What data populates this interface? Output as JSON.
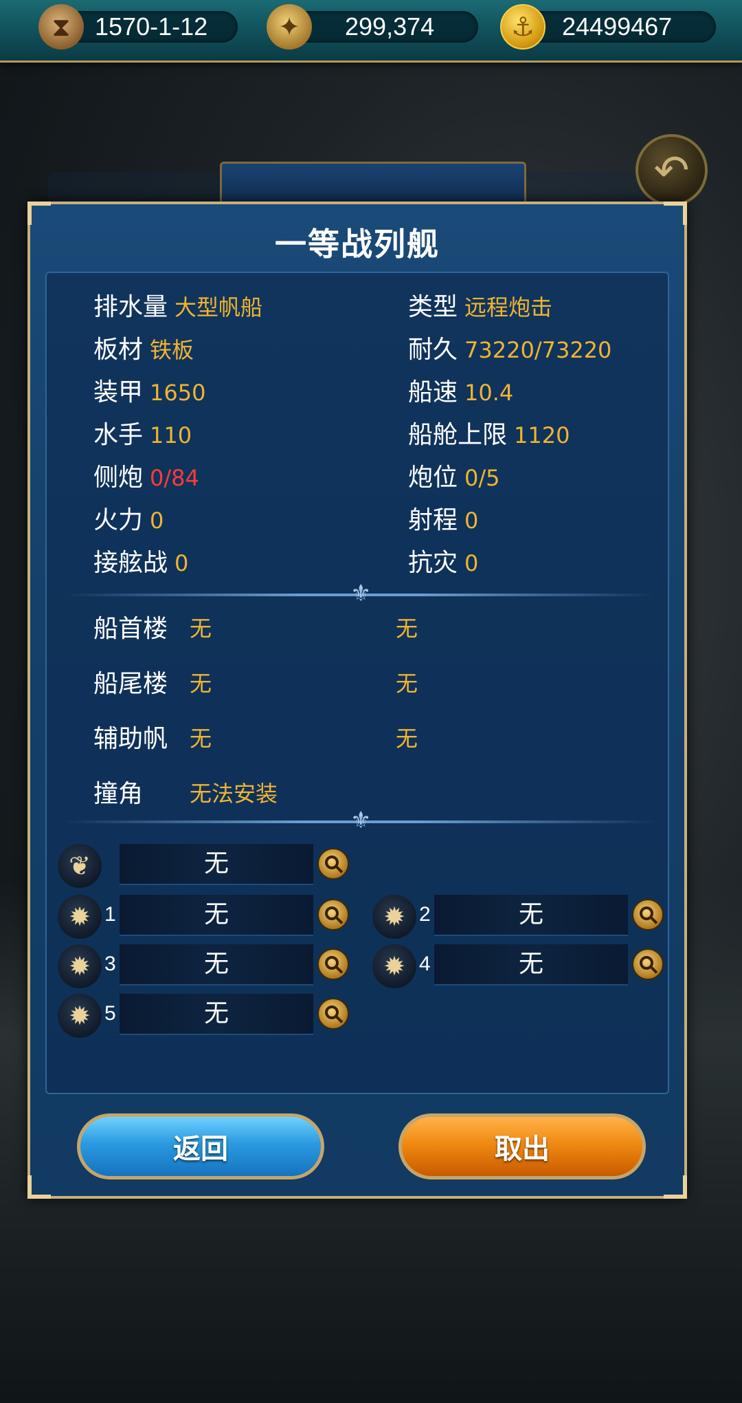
{
  "resources": {
    "date": "1570-1-12",
    "compass_value": "299,374",
    "gold": "24499467"
  },
  "modal": {
    "title": "一等战列舰",
    "stats_left": [
      {
        "label": "排水量",
        "value": "大型帆船"
      },
      {
        "label": "板材",
        "value": "铁板"
      },
      {
        "label": "装甲",
        "value": "1650"
      },
      {
        "label": "水手",
        "value": "110"
      },
      {
        "label": "侧炮",
        "value": "0/84"
      },
      {
        "label": "火力",
        "value": "0"
      },
      {
        "label": "接舷战",
        "value": "0"
      }
    ],
    "stats_right": [
      {
        "label": "类型",
        "value": "远程炮击"
      },
      {
        "label": "耐久",
        "value": "73220/73220"
      },
      {
        "label": "船速",
        "value": "10.4"
      },
      {
        "label": "船舱上限",
        "value": "1120"
      },
      {
        "label": "炮位",
        "value": "0/5"
      },
      {
        "label": "射程",
        "value": "0"
      },
      {
        "label": "抗灾",
        "value": "0"
      }
    ],
    "equipment": [
      {
        "label": "船首楼",
        "value1": "无",
        "value2": "无"
      },
      {
        "label": "船尾楼",
        "value1": "无",
        "value2": "无"
      },
      {
        "label": "辅助帆",
        "value1": "无",
        "value2": "无"
      },
      {
        "label": "撞角",
        "value1": "无法安装",
        "value2": ""
      }
    ],
    "slots": {
      "sail": {
        "value": "无"
      },
      "cannons": [
        {
          "num": "1",
          "value": "无"
        },
        {
          "num": "2",
          "value": "无"
        },
        {
          "num": "3",
          "value": "无"
        },
        {
          "num": "4",
          "value": "无"
        },
        {
          "num": "5",
          "value": "无"
        }
      ]
    },
    "buttons": {
      "back": "返回",
      "take_out": "取出"
    }
  },
  "colors": {
    "value_gold": "#f0b432",
    "value_red": "#ff3a3a",
    "panel_blue": "#15406a",
    "frame_gold": "#c8b07c"
  }
}
